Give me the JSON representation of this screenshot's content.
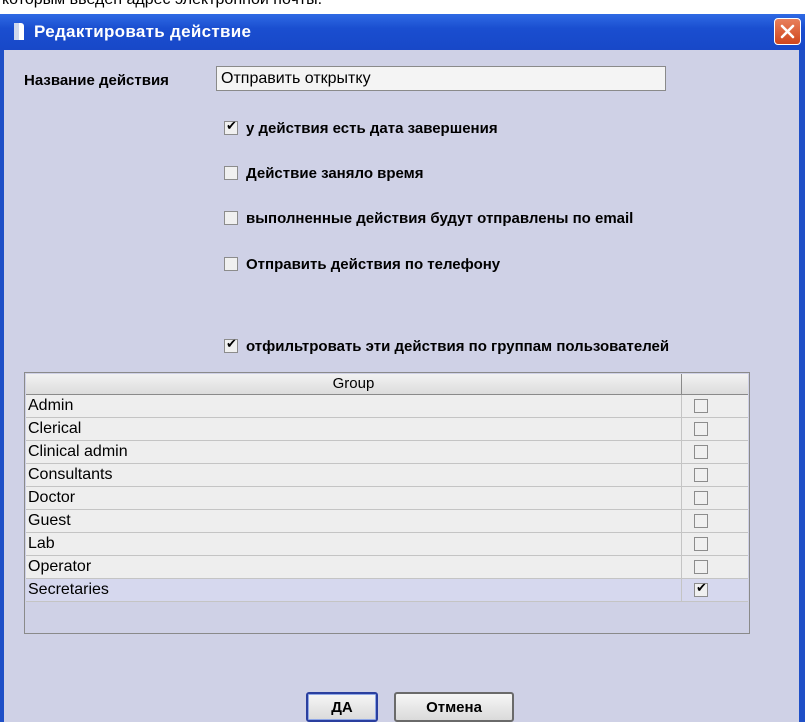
{
  "background_caption": "которым введен адрес электронной почты.",
  "dialog": {
    "title": "Редактировать действие",
    "close_icon": "close-icon"
  },
  "form": {
    "name_label": "Название действия",
    "name_value": "Отправить открытку"
  },
  "options": [
    {
      "label": "у действия есть дата завершения",
      "checked": true
    },
    {
      "label": "Действие заняло время",
      "checked": false
    },
    {
      "label": "выполненные действия будут отправлены по email",
      "checked": false
    },
    {
      "label": "Отправить действия по телефону",
      "checked": false
    },
    {
      "label": "отфильтровать эти действия по группам пользователей",
      "checked": true
    }
  ],
  "groups_table": {
    "header": "Group",
    "rows": [
      {
        "name": "Admin",
        "checked": false
      },
      {
        "name": "Clerical",
        "checked": false
      },
      {
        "name": "Clinical admin",
        "checked": false
      },
      {
        "name": "Consultants",
        "checked": false
      },
      {
        "name": "Doctor",
        "checked": false
      },
      {
        "name": "Guest",
        "checked": false
      },
      {
        "name": "Lab",
        "checked": false
      },
      {
        "name": "Operator",
        "checked": false
      },
      {
        "name": "Secretaries",
        "checked": true
      }
    ]
  },
  "buttons": {
    "ok_label": "ДА",
    "cancel_label": "Отмена"
  },
  "colors": {
    "titlebar": "#1f4fc7",
    "client_bg": "#cfd1e6",
    "close_button": "#d9552b"
  }
}
